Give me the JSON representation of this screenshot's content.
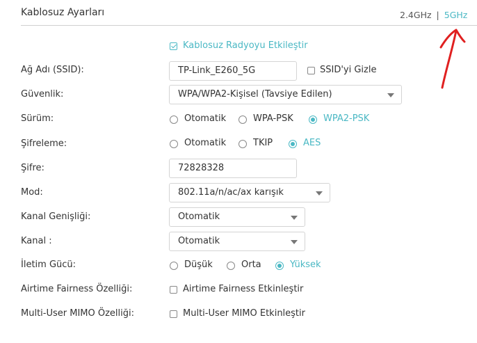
{
  "header": {
    "title": "Kablosuz Ayarları",
    "band_24": "2.4GHz",
    "separator": "|",
    "band_5": "5GHz"
  },
  "enable_radio": {
    "label": "Kablosuz Radyoyu Etkileştir",
    "checked": true
  },
  "ssid": {
    "label": "Ağ Adı (SSID):",
    "value": "TP-Link_E260_5G",
    "hide_label": "SSID'yi Gizle",
    "hidden": false
  },
  "security": {
    "label": "Güvenlik:",
    "value": "WPA/WPA2-Kişisel (Tavsiye Edilen)"
  },
  "version": {
    "label": "Sürüm:",
    "options": [
      "Otomatik",
      "WPA-PSK",
      "WPA2-PSK"
    ],
    "selected": "WPA2-PSK"
  },
  "encryption": {
    "label": "Şifreleme:",
    "options": [
      "Otomatik",
      "TKIP",
      "AES"
    ],
    "selected": "AES"
  },
  "password": {
    "label": "Şifre:",
    "value": "72828328"
  },
  "mode": {
    "label": "Mod:",
    "value": "802.11a/n/ac/ax karışık"
  },
  "channel_width": {
    "label": "Kanal Genişliği:",
    "value": "Otomatik"
  },
  "channel": {
    "label": "Kanal :",
    "value": "Otomatik"
  },
  "tx_power": {
    "label": "İletim Gücü:",
    "options": [
      "Düşük",
      "Orta",
      "Yüksek"
    ],
    "selected": "Yüksek"
  },
  "airtime": {
    "label": "Airtime Fairness Özelliği:",
    "checkbox_label": "Airtime Fairness Etkinleştir",
    "checked": false
  },
  "mumimo": {
    "label": "Multi-User MIMO Özelliği:",
    "checkbox_label": "Multi-User MIMO Etkinleştir",
    "checked": false
  },
  "colors": {
    "accent": "#4ab8c4",
    "annotation": "#e02020"
  }
}
